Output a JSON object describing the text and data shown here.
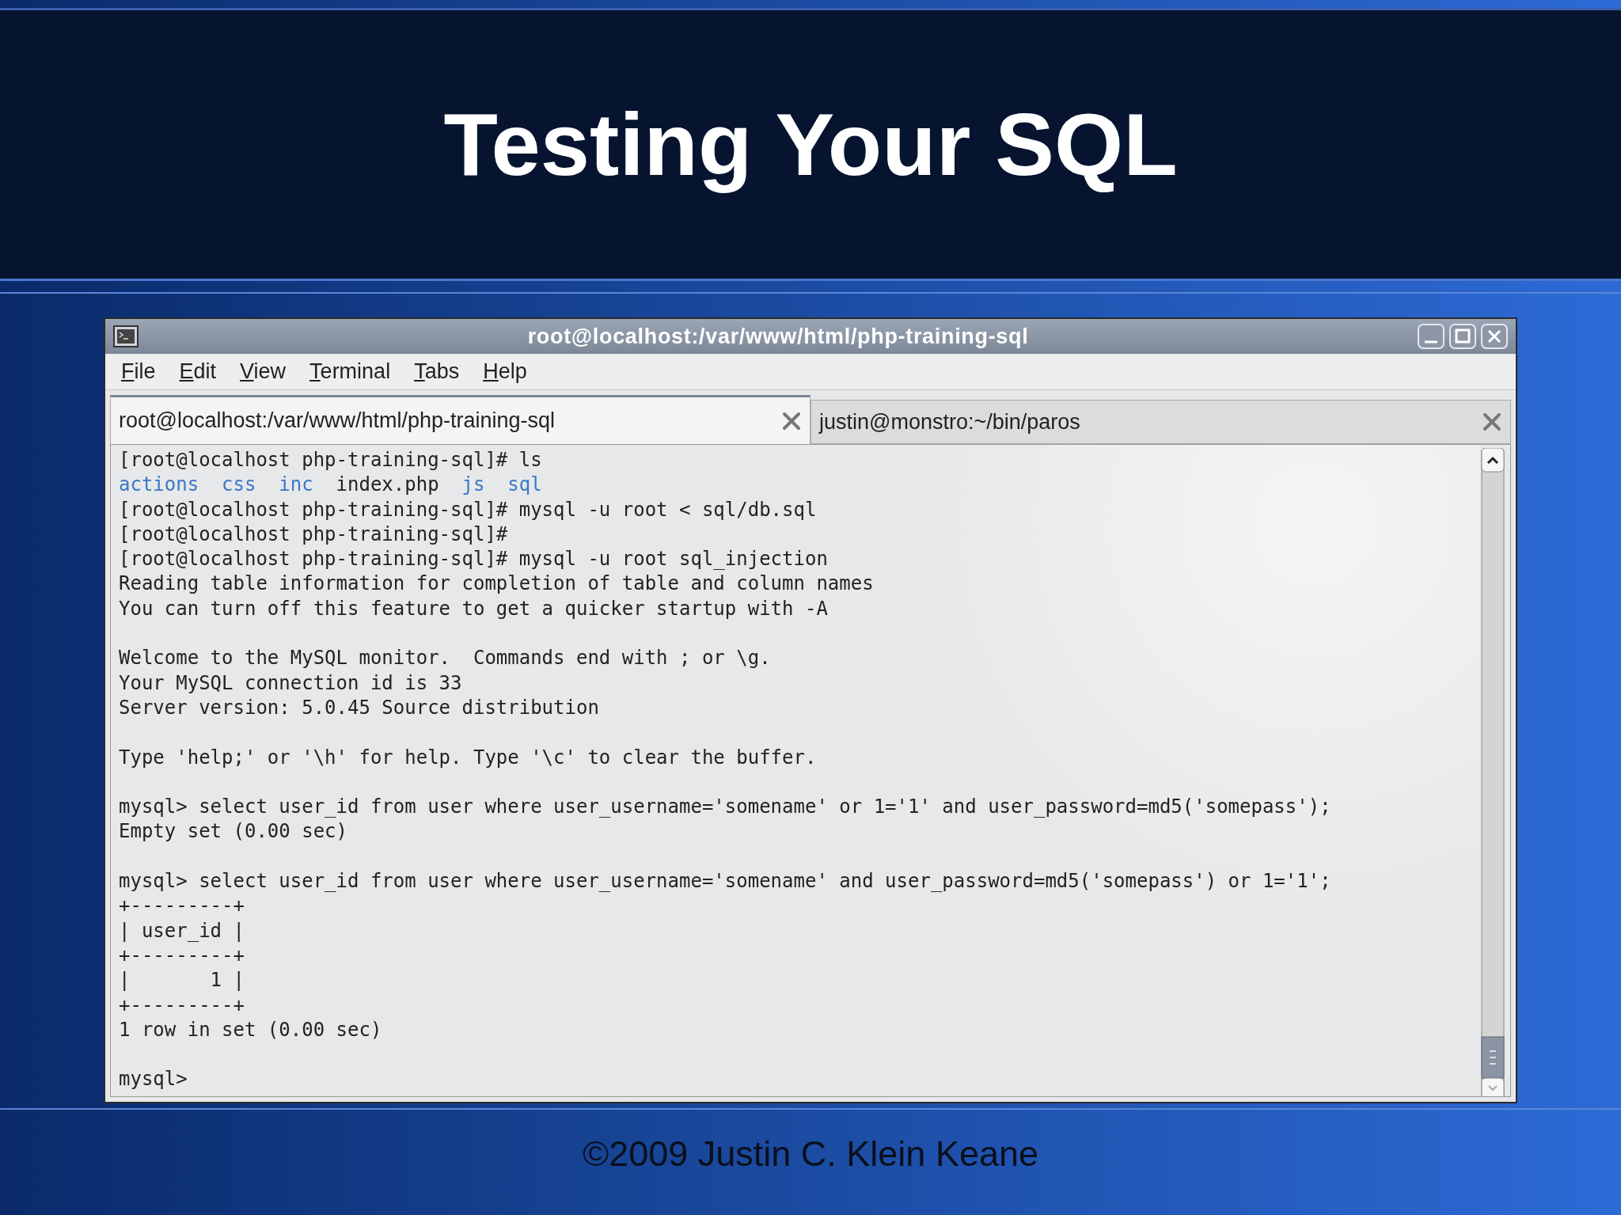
{
  "slide": {
    "title": "Testing Your SQL",
    "footer": "©2009 Justin C. Klein Keane"
  },
  "window": {
    "title": "root@localhost:/var/www/html/php-training-sql"
  },
  "menu": [
    "File",
    "Edit",
    "View",
    "Terminal",
    "Tabs",
    "Help"
  ],
  "tabs": [
    {
      "label": "root@localhost:/var/www/html/php-training-sql",
      "selected": true
    },
    {
      "label": "justin@monstro:~/bin/paros",
      "selected": false
    }
  ],
  "terminal_lines": [
    {
      "kind": "text",
      "text": "[root@localhost php-training-sql]# ls"
    },
    {
      "kind": "listing",
      "items": [
        {
          "text": "actions",
          "kind": "dir"
        },
        {
          "text": "css",
          "kind": "dir"
        },
        {
          "text": "inc",
          "kind": "dir"
        },
        {
          "text": "index.php",
          "kind": "file"
        },
        {
          "text": "js",
          "kind": "dir"
        },
        {
          "text": "sql",
          "kind": "dir"
        }
      ]
    },
    {
      "kind": "text",
      "text": "[root@localhost php-training-sql]# mysql -u root < sql/db.sql"
    },
    {
      "kind": "text",
      "text": "[root@localhost php-training-sql]#"
    },
    {
      "kind": "text",
      "text": "[root@localhost php-training-sql]# mysql -u root sql_injection"
    },
    {
      "kind": "text",
      "text": "Reading table information for completion of table and column names"
    },
    {
      "kind": "text",
      "text": "You can turn off this feature to get a quicker startup with -A"
    },
    {
      "kind": "blank"
    },
    {
      "kind": "text",
      "text": "Welcome to the MySQL monitor.  Commands end with ; or \\g."
    },
    {
      "kind": "text",
      "text": "Your MySQL connection id is 33"
    },
    {
      "kind": "text",
      "text": "Server version: 5.0.45 Source distribution"
    },
    {
      "kind": "blank"
    },
    {
      "kind": "text",
      "text": "Type 'help;' or '\\h' for help. Type '\\c' to clear the buffer."
    },
    {
      "kind": "blank"
    },
    {
      "kind": "text",
      "text": "mysql> select user_id from user where user_username='somename' or 1='1' and user_password=md5('somepass');"
    },
    {
      "kind": "text",
      "text": "Empty set (0.00 sec)"
    },
    {
      "kind": "blank"
    },
    {
      "kind": "text",
      "text": "mysql> select user_id from user where user_username='somename' and user_password=md5('somepass') or 1='1';"
    },
    {
      "kind": "text",
      "text": "+---------+"
    },
    {
      "kind": "text",
      "text": "| user_id |"
    },
    {
      "kind": "text",
      "text": "+---------+"
    },
    {
      "kind": "text",
      "text": "|       1 |"
    },
    {
      "kind": "text",
      "text": "+---------+"
    },
    {
      "kind": "text",
      "text": "1 row in set (0.00 sec)"
    },
    {
      "kind": "blank"
    },
    {
      "kind": "text",
      "text": "mysql>"
    }
  ]
}
